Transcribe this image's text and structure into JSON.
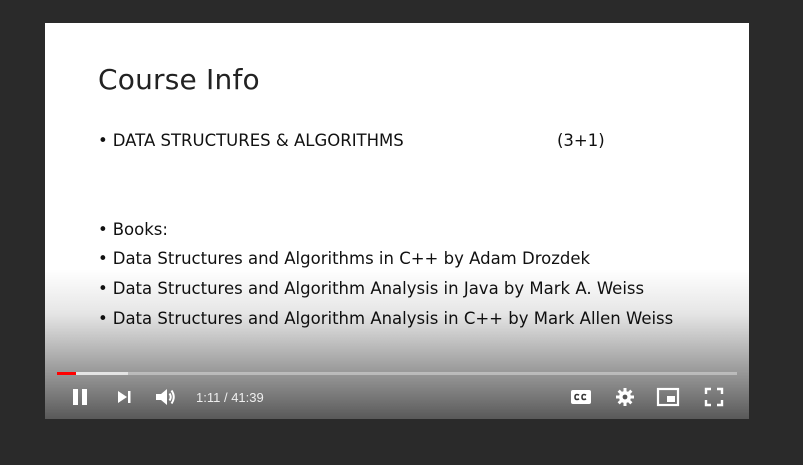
{
  "slide": {
    "title": "Course Info",
    "course": "DATA STRUCTURES & ALGORITHMS",
    "credit_hours": "(3+1)",
    "books_heading": "Books:",
    "books": [
      "Data Structures and Algorithms in C++ by Adam Drozdek",
      "Data Structures and Algorithm Analysis in Java by Mark A. Weiss",
      "Data Structures and Algorithm Analysis in C++ by Mark Allen Weiss"
    ],
    "bullet_char": "•"
  },
  "player": {
    "current_time": "1:11",
    "separator": " / ",
    "duration": "41:39",
    "played_fraction": 0.028,
    "buffered_fraction": 0.105,
    "colors": {
      "played": "#ff0000",
      "controls": "#ffffff"
    },
    "icons": {
      "play_pause": "pause-icon",
      "next": "next-icon",
      "volume": "volume-icon",
      "captions": "captions-icon",
      "settings": "gear-icon",
      "miniplayer": "miniplayer-icon",
      "fullscreen": "fullscreen-icon"
    }
  }
}
